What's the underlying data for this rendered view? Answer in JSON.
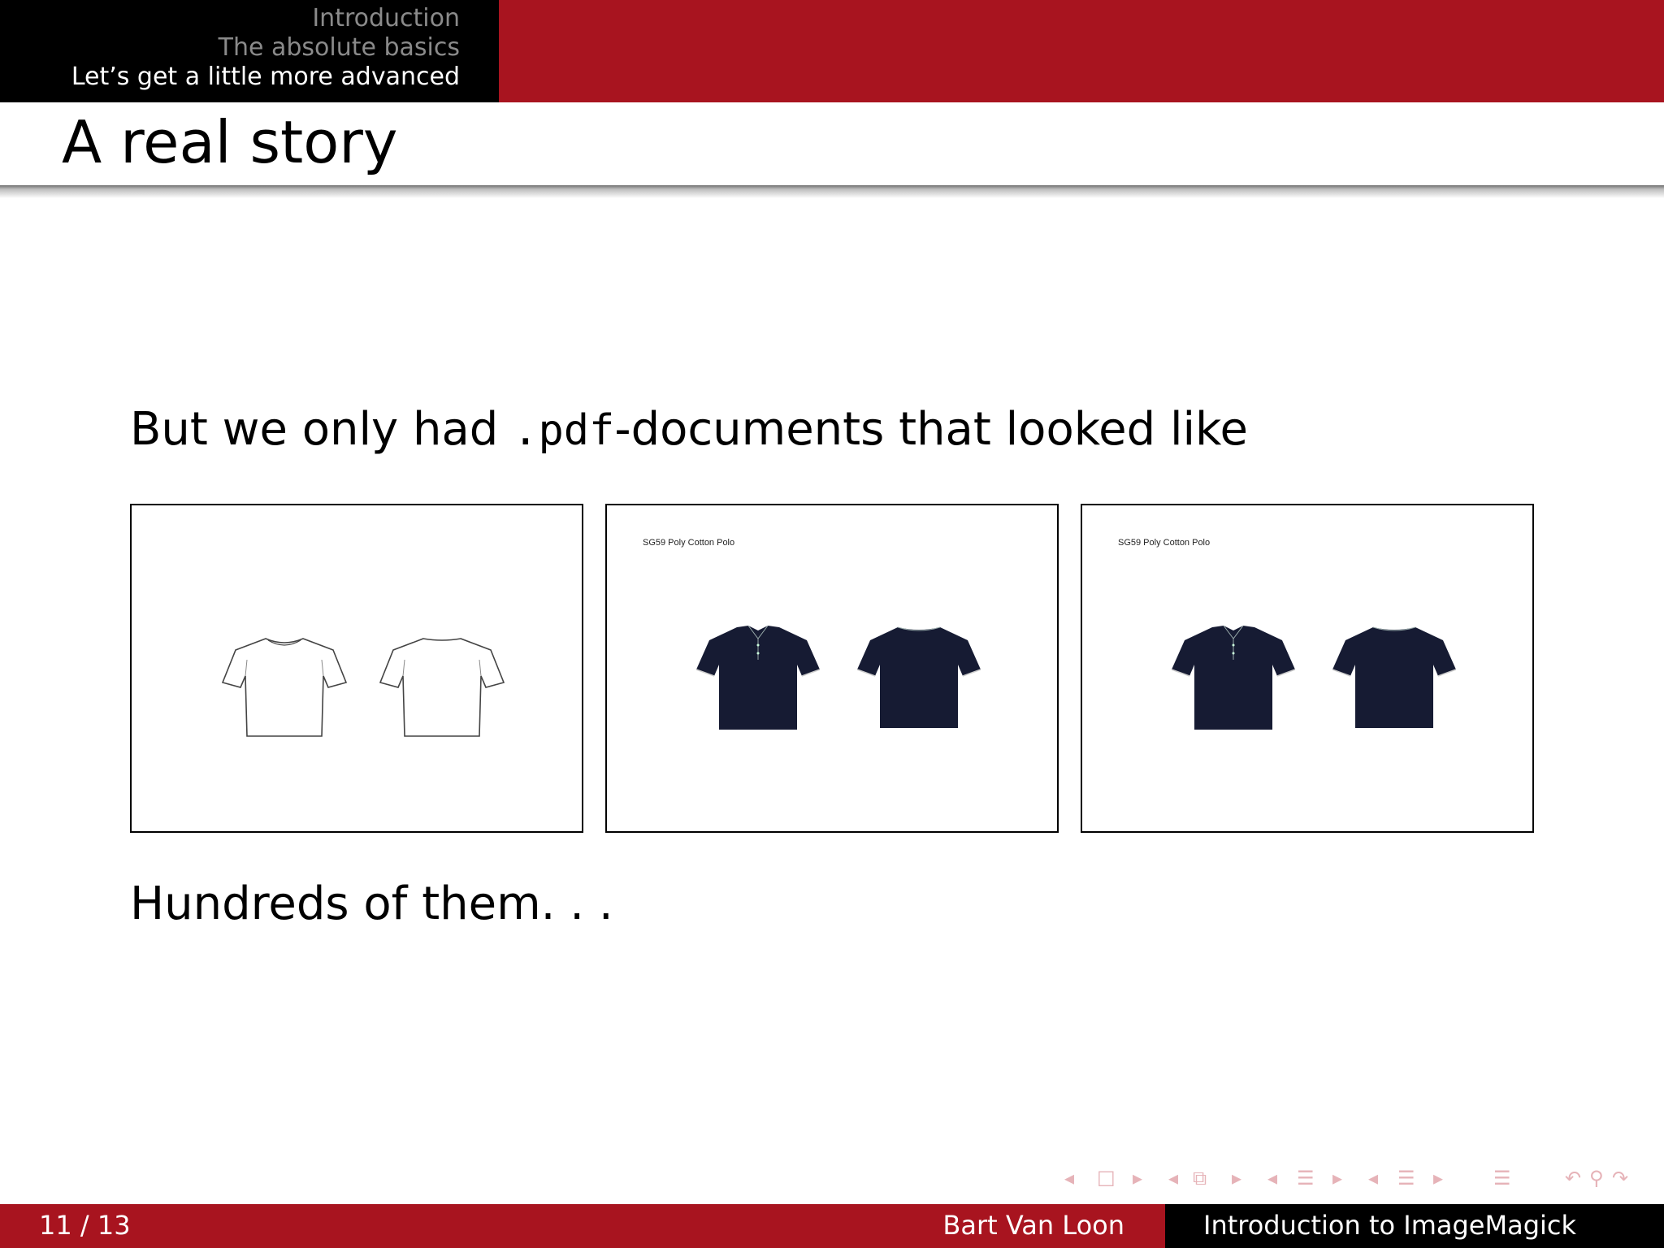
{
  "header": {
    "sections": [
      {
        "label": "Introduction",
        "active": false
      },
      {
        "label": "The absolute basics",
        "active": false
      },
      {
        "label": "Let’s get a little more advanced",
        "active": true
      }
    ]
  },
  "frame": {
    "title": "A real story",
    "intro_before": "But we only had ",
    "intro_code": ".pdf",
    "intro_after": "-documents that looked like",
    "closing": "Hundreds of them. . ."
  },
  "documents": [
    {
      "label": "",
      "garment": "white t-shirt outline",
      "color": "#ffffff"
    },
    {
      "label": "SG59 Poly Cotton Polo",
      "garment": "navy polo shirt",
      "color": "#161b33"
    },
    {
      "label": "SG59 Poly Cotton Polo",
      "garment": "navy polo shirt",
      "color": "#161b33"
    }
  ],
  "footer": {
    "page": "11 / 13",
    "author": "Bart Van Loon",
    "title": "Introduction to ImageMagick"
  },
  "colors": {
    "theme_red": "#a8141f",
    "black": "#000000",
    "nav_symbol": "#e6b3b8"
  }
}
